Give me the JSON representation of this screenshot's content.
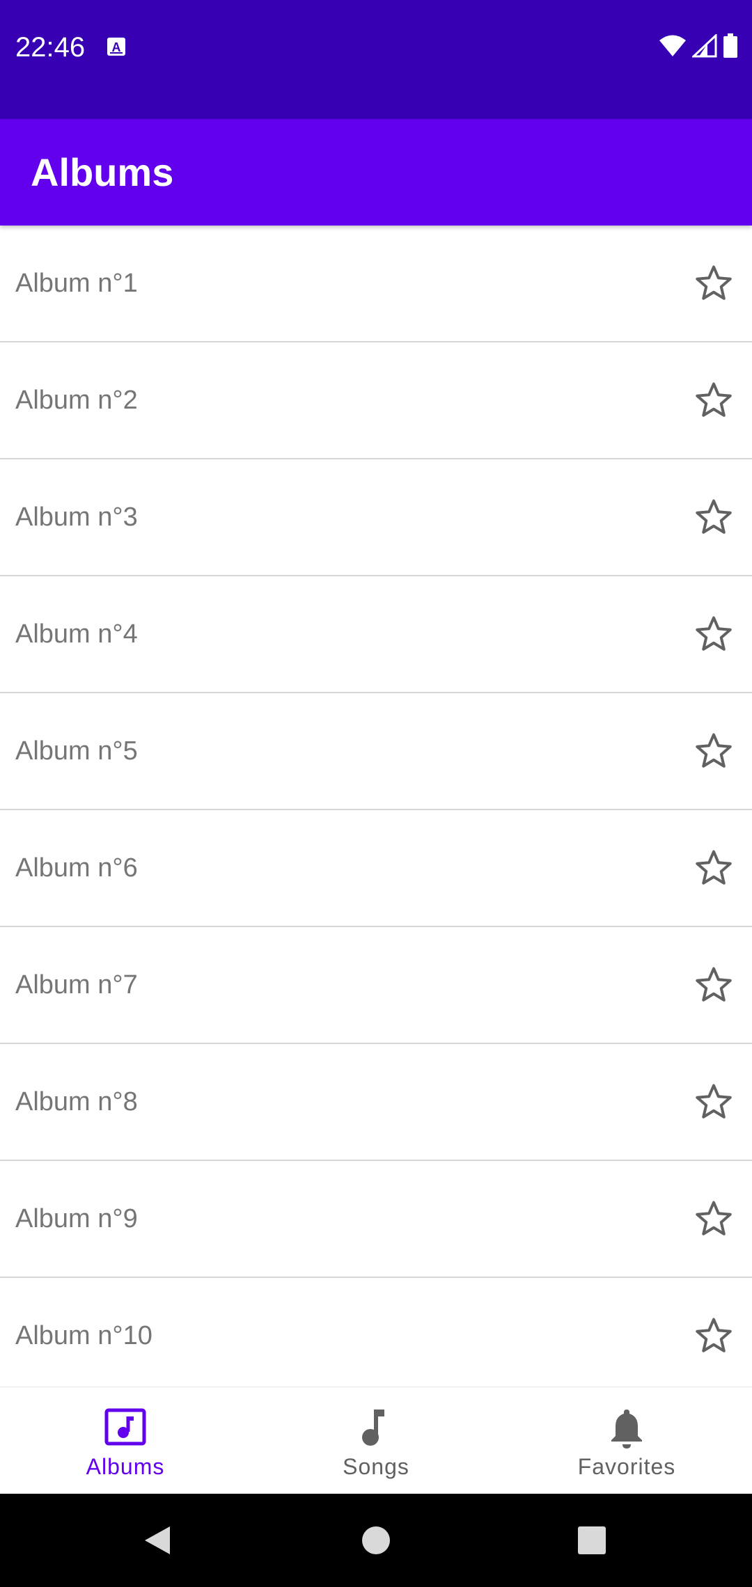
{
  "status_bar": {
    "time": "22:46",
    "icons": [
      "text-notification-icon",
      "wifi-icon",
      "signal-icon",
      "battery-icon"
    ]
  },
  "app_bar": {
    "title": "Albums"
  },
  "albums": [
    {
      "label": "Album n°1",
      "favorite": false
    },
    {
      "label": "Album n°2",
      "favorite": false
    },
    {
      "label": "Album n°3",
      "favorite": false
    },
    {
      "label": "Album n°4",
      "favorite": false
    },
    {
      "label": "Album n°5",
      "favorite": false
    },
    {
      "label": "Album n°6",
      "favorite": false
    },
    {
      "label": "Album n°7",
      "favorite": false
    },
    {
      "label": "Album n°8",
      "favorite": false
    },
    {
      "label": "Album n°9",
      "favorite": false
    },
    {
      "label": "Album n°10",
      "favorite": false
    }
  ],
  "bottom_nav": {
    "items": [
      {
        "label": "Albums",
        "icon": "album-icon",
        "active": true
      },
      {
        "label": "Songs",
        "icon": "music-note-icon",
        "active": false
      },
      {
        "label": "Favorites",
        "icon": "bell-icon",
        "active": false
      }
    ]
  },
  "system_nav": {
    "buttons": [
      "back-icon",
      "home-icon",
      "recents-icon"
    ]
  },
  "colors": {
    "status_bar": "#3700b3",
    "primary": "#6200ee",
    "text_secondary": "#757575",
    "icon_inactive": "#616161",
    "divider": "#d6d6d6"
  }
}
